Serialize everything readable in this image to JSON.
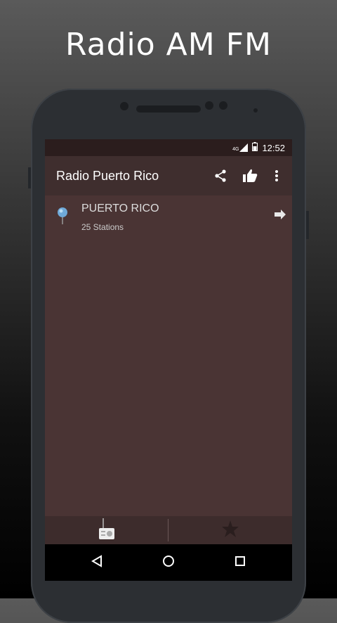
{
  "promo": {
    "title": "Radio AM FM"
  },
  "status_bar": {
    "network": "4G",
    "time": "12:52"
  },
  "app_bar": {
    "title": "Radio Puerto Rico",
    "actions": [
      "share-icon",
      "thumbs-up-icon",
      "overflow-menu-icon"
    ]
  },
  "list": {
    "items": [
      {
        "title": "PUERTO RICO",
        "subtitle": "25 Stations",
        "icon": "map-pin-icon",
        "action_icon": "arrow-right-icon"
      }
    ]
  },
  "bottom_tabs": [
    {
      "icon": "radio-icon"
    },
    {
      "icon": "star-icon"
    }
  ],
  "nav_bar": [
    "back-icon",
    "home-icon",
    "recents-icon"
  ],
  "colors": {
    "status_bar": "#2b1d1d",
    "app_bar": "#3f2e2e",
    "content_bg": "#4a3434",
    "bottom_tabs": "#3d2c2c"
  }
}
